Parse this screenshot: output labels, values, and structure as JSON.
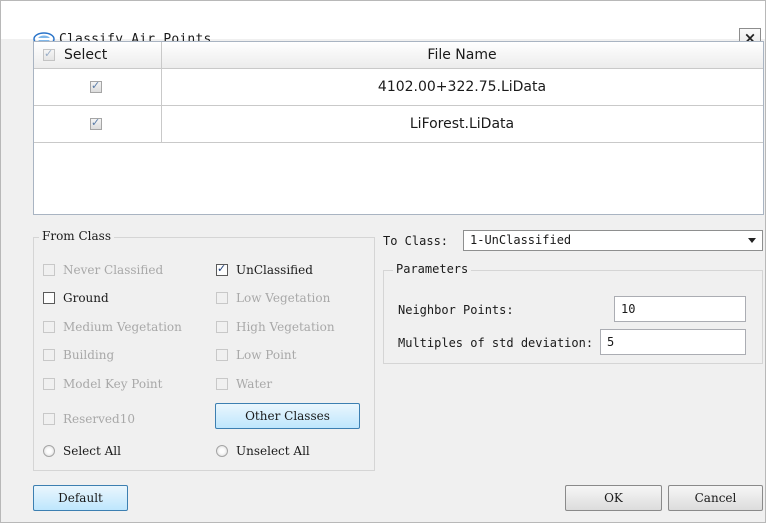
{
  "window": {
    "title": "Classify Air Points",
    "close_label": "×"
  },
  "file_grid": {
    "headers": [
      "Select",
      "File Name"
    ],
    "rows": [
      {
        "checked": true,
        "file_name": "4102.00+322.75.LiData"
      },
      {
        "checked": true,
        "file_name": "LiForest.LiData"
      }
    ]
  },
  "from_class": {
    "title": "From Class",
    "options": [
      {
        "label": "Never Classified",
        "checked": false,
        "enabled": false
      },
      {
        "label": "UnClassified",
        "checked": true,
        "enabled": true
      },
      {
        "label": "Ground",
        "checked": false,
        "enabled": true
      },
      {
        "label": "Low Vegetation",
        "checked": false,
        "enabled": false
      },
      {
        "label": "Medium Vegetation",
        "checked": false,
        "enabled": false
      },
      {
        "label": "High Vegetation",
        "checked": false,
        "enabled": false
      },
      {
        "label": "Building",
        "checked": false,
        "enabled": false
      },
      {
        "label": "Low Point",
        "checked": false,
        "enabled": false
      },
      {
        "label": "Model Key Point",
        "checked": false,
        "enabled": false
      },
      {
        "label": "Water",
        "checked": false,
        "enabled": false
      },
      {
        "label": "Reserved10",
        "checked": false,
        "enabled": false
      }
    ],
    "other_classes_label": "Other Classes",
    "select_all_label": "Select All",
    "unselect_all_label": "Unselect All"
  },
  "to_class": {
    "label": "To Class:",
    "selected": "1-UnClassified"
  },
  "parameters": {
    "title": "Parameters",
    "neighbor_points_label": "Neighbor Points:",
    "neighbor_points_value": "10",
    "std_dev_label": "Multiples of std deviation:",
    "std_dev_value": "5"
  },
  "buttons": {
    "default_label": "Default",
    "ok_label": "OK",
    "cancel_label": "Cancel"
  },
  "colors": {
    "accent_button": "#bee6fd",
    "check_mark": "#5b7da8"
  }
}
